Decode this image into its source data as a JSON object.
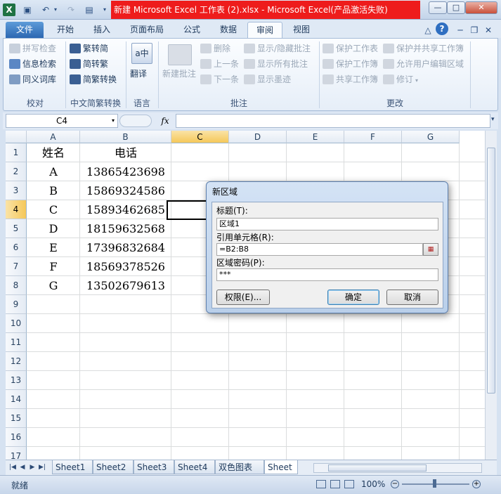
{
  "title_bar": {
    "title": "新建 Microsoft Excel 工作表 (2).xlsx  -  Microsoft Excel(产品激活失败)",
    "minimize_label": "—",
    "maximize_label": "□",
    "close_label": "✕"
  },
  "ribbon_tabs": [
    "文件",
    "开始",
    "插入",
    "页面布局",
    "公式",
    "数据",
    "审阅",
    "视图"
  ],
  "ribbon": {
    "proofing": {
      "spell_check": "拼写检查",
      "research": "信息检索",
      "thesaurus": "同义词库",
      "group": "校对"
    },
    "chinese_conversion": {
      "to_simplified": "繁转简",
      "to_traditional": "简转繁",
      "convert": "简繁转换",
      "group": "中文简繁转换"
    },
    "language": {
      "translate": "翻译",
      "group": "语言"
    },
    "comments": {
      "new_comment": "新建批注",
      "delete": "删除",
      "previous": "上一条",
      "next": "下一条",
      "show_hide": "显示/隐藏批注",
      "show_all": "显示所有批注",
      "show_ink": "显示墨迹",
      "group": "批注"
    },
    "changes": {
      "protect_sheet": "保护工作表",
      "protect_workbook": "保护工作簿",
      "share_workbook": "共享工作簿",
      "protect_share": "保护并共享工作簿",
      "allow_edit_ranges": "允许用户编辑区域",
      "track_changes": "修订",
      "group": "更改"
    }
  },
  "formula_bar": {
    "name_box": "C4",
    "fx": "fx",
    "value": ""
  },
  "columns": [
    "A",
    "B",
    "C",
    "D",
    "E",
    "F",
    "G"
  ],
  "rows": [
    "1",
    "2",
    "3",
    "4",
    "5",
    "6",
    "7",
    "8",
    "9",
    "10",
    "11",
    "12",
    "13",
    "14",
    "15",
    "16",
    "17"
  ],
  "selected_cell": {
    "column": "C",
    "row": "4"
  },
  "table": {
    "headers": [
      "姓名",
      "电话"
    ],
    "data": [
      [
        "A",
        "13865423698"
      ],
      [
        "B",
        "15869324586"
      ],
      [
        "C",
        "15893462685"
      ],
      [
        "D",
        "18159632568"
      ],
      [
        "E",
        "17396832684"
      ],
      [
        "F",
        "18569378526"
      ],
      [
        "G",
        "13502679613"
      ]
    ]
  },
  "sheet_tabs": [
    "Sheet1",
    "Sheet2",
    "Sheet3",
    "Sheet4",
    "双色图表",
    "Sheet"
  ],
  "status_bar": {
    "status": "就绪",
    "zoom": "100%"
  },
  "dialog": {
    "title": "新区域",
    "title_label": "标题(T):",
    "title_value": "区域1",
    "refers_label": "引用单元格(R):",
    "refers_value": "=B2:B8",
    "password_label": "区域密码(P):",
    "password_value": "***",
    "permissions_button": "权限(E)...",
    "ok_button": "确定",
    "cancel_button": "取消"
  },
  "colors": {
    "title_red": "#ee1c1c",
    "selected_header": "#f5c85a",
    "ribbon_blue": "#2c67b1"
  }
}
